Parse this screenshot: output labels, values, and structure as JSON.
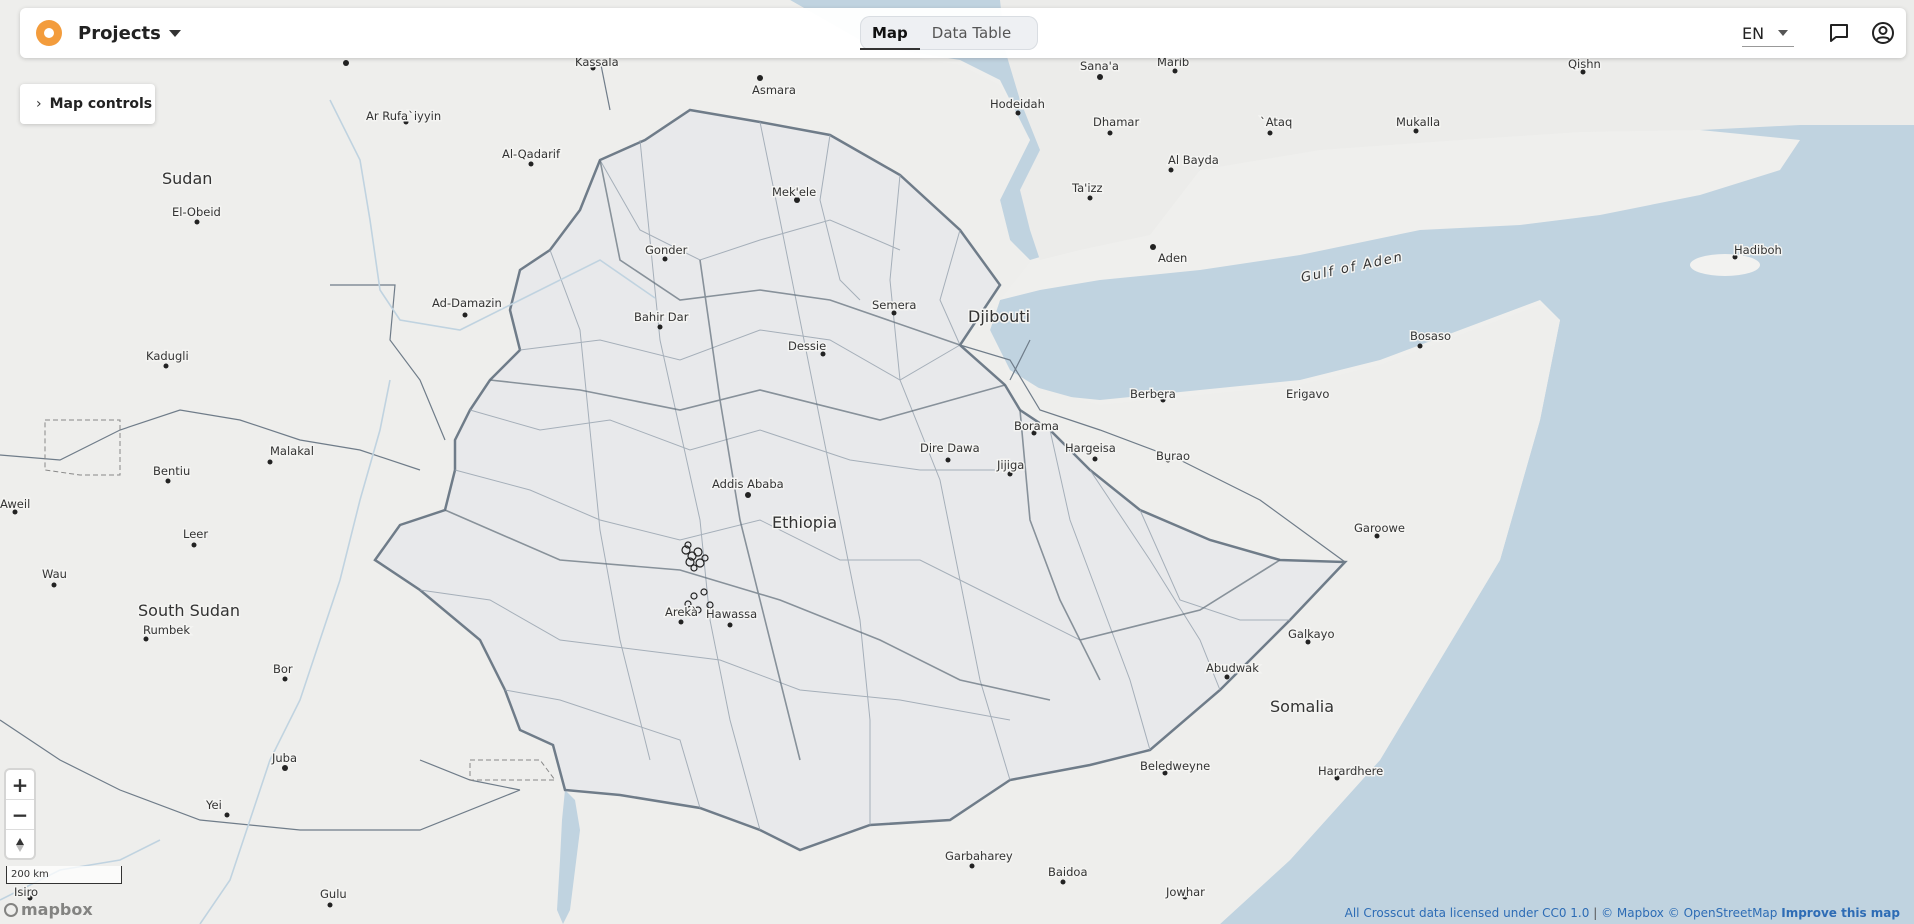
{
  "header": {
    "title": "Projects",
    "tabs": [
      {
        "label": "Map",
        "active": true
      },
      {
        "label": "Data Table",
        "active": false
      }
    ],
    "language": "EN"
  },
  "map_controls": {
    "label": "Map controls"
  },
  "zoom": {
    "in": "+",
    "out": "−"
  },
  "scale": {
    "label": "200 km"
  },
  "mapbox_logo": "mapbox",
  "attribution": {
    "crosscut": "All Crosscut data licensed under CC0 1.0",
    "separator": "|",
    "mapbox": "© Mapbox",
    "osm": "© OpenStreetMap",
    "improve": "Improve this map"
  },
  "map_labels": {
    "countries": [
      "Sudan",
      "South Sudan",
      "Ethiopia",
      "Djibouti",
      "Somalia"
    ],
    "water": [
      "Gulf of Aden"
    ],
    "cities": [
      "Kassala",
      "Asmara",
      "Sana'a",
      "Marib",
      "Qishn",
      "Ar Rufa`iyyin",
      "Hodeidah",
      "Dhamar",
      "`Ataq",
      "Mukalla",
      "Al-Qadarif",
      "Mek'ele",
      "Al Bayda",
      "El-Obeid",
      "Ta'izz",
      "Gonder",
      "Aden",
      "Hadiboh",
      "Ad-Damazin",
      "Semera",
      "Bahir Dar",
      "Kadugli",
      "Dessie",
      "Bosaso",
      "Erigavo",
      "Berbera",
      "Borama",
      "Dire Dawa",
      "Jijiga",
      "Hargeisa",
      "Burao",
      "Malakal",
      "Bentiu",
      "Aweil",
      "Addis Ababa",
      "Leer",
      "Garoowe",
      "Wau",
      "Arekà",
      "Hawassa",
      "Galkayo",
      "Rumbek",
      "Abudwak",
      "Bor",
      "Juba",
      "Beledweyne",
      "Harardhere",
      "Yei",
      "Garbaharey",
      "Baidoa",
      "Jowhar",
      "Gulu",
      "Isiro"
    ]
  }
}
